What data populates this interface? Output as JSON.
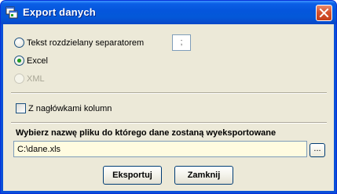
{
  "window": {
    "title": "Export danych"
  },
  "options": {
    "text_separated_label": "Tekst rozdzielany separatorem",
    "separator_value": ";",
    "excel_label": "Excel",
    "xml_label": "XML",
    "selected": "Excel"
  },
  "headers": {
    "checkbox_label": "Z nagłówkami kolumn",
    "checked": false
  },
  "file": {
    "section_title": "Wybierz nazwę pliku do którego dane zostaną wyeksportowane",
    "path": "C:\\dane.xls",
    "browse_label": "..."
  },
  "buttons": {
    "export_label": "Eksportuj",
    "close_label": "Zamknij"
  },
  "colors": {
    "titlebar": "#0556dc",
    "dialog_bg": "#ece9d8",
    "input_bg": "#fffbe0",
    "close_red": "#d5532f"
  },
  "icons": {
    "title": "export-window-icon",
    "close": "close-icon"
  }
}
